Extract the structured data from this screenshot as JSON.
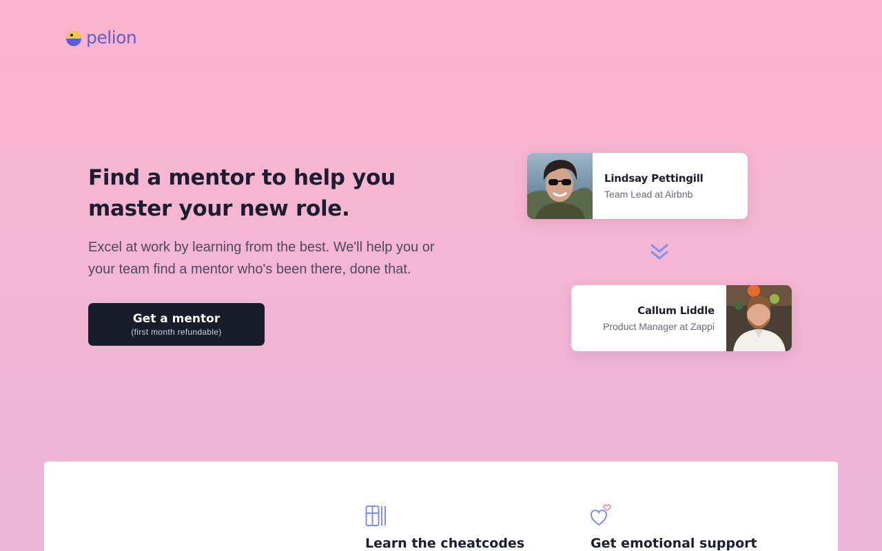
{
  "brand": {
    "name": "pelion",
    "colors": {
      "primary": "#5b5ed1",
      "accent_yellow": "#f5c842",
      "dark": "#181c2b"
    }
  },
  "hero": {
    "title": "Find a mentor to help you master your new role.",
    "subtitle": "Excel at work by learning from the best. We'll help you or your team find a mentor who's been there, done that.",
    "cta": {
      "label": "Get a mentor",
      "sublabel": "(first month refundable)"
    }
  },
  "mentors": [
    {
      "name": "Lindsay Pettingill",
      "role": "Team Lead at Airbnb"
    },
    {
      "name": "Callum Liddle",
      "role": "Product Manager at Zappi"
    }
  ],
  "connector_icon": "double-chevron-down-icon",
  "features": [
    {
      "icon": "book-shelf-icon",
      "title": "Learn the cheatcodes"
    },
    {
      "icon": "hearts-icon",
      "title": "Get emotional support"
    }
  ]
}
